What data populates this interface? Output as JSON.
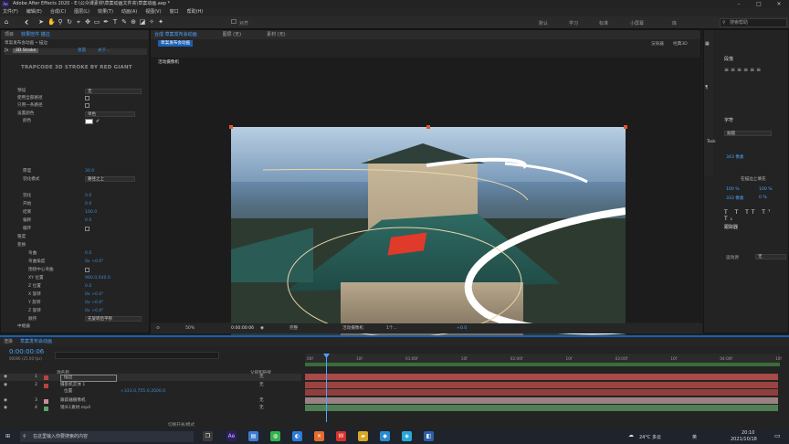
{
  "app": {
    "title": "Adobe After Effects 2020 - E:\\公众课素材\\草案动画文件夹\\草案动画.aep *"
  },
  "menu": [
    "文件(F)",
    "编辑(E)",
    "合成(C)",
    "图层(L)",
    "效果(T)",
    "动画(A)",
    "视图(V)",
    "窗口",
    "帮助(H)"
  ],
  "toolbar": {
    "snap_label": "对齐",
    "workspaces": [
      "默认",
      "学习",
      "标准",
      "小屏幕",
      "库"
    ],
    "search_placeholder": "搜索帮助"
  },
  "effects_panel": {
    "tabs": [
      "项目",
      "效果控件 描边"
    ],
    "header": "草案发布会动画 • 描边",
    "fx_name": "3D Stroke",
    "reset_label": "重置",
    "about_label": "关于...",
    "plugin_title": "TRAPCODE 3D STROKE BY RED GIANT",
    "rows": [
      {
        "label": "预设",
        "value": "无"
      },
      {
        "label": "使用全部路径",
        "value": ""
      },
      {
        "label": "只用一条路径",
        "value": ""
      },
      {
        "label": "设置颜色",
        "value": "单色"
      },
      {
        "label": "颜色",
        "value": ""
      },
      {
        "label": "厚度",
        "value": "30.0"
      },
      {
        "label": "羽化",
        "value": "0.0"
      },
      {
        "label": "开始",
        "value": "0.0"
      },
      {
        "label": "结束",
        "value": "100.0"
      },
      {
        "label": "偏移",
        "value": "0.0"
      },
      {
        "label": "循环",
        "value": ""
      },
      {
        "label": "锥度",
        "value": ""
      },
      {
        "label": "变换",
        "value": ""
      },
      {
        "label": "弯曲",
        "value": "0.0"
      },
      {
        "label": "弯曲角度",
        "value": "0x +0.0°"
      },
      {
        "label": "围绕中心弯曲",
        "value": ""
      },
      {
        "label": "XY 位置",
        "value": "960.0,540.0"
      },
      {
        "label": "Z 位置",
        "value": "0.0"
      },
      {
        "label": "X 旋转",
        "value": "0x +0.0°"
      },
      {
        "label": "Y 旋转",
        "value": "0x +0.0°"
      },
      {
        "label": "Z 旋转",
        "value": "0x +0.0°"
      },
      {
        "label": "顺序",
        "value": "先旋转后平移"
      },
      {
        "label": "中继器",
        "value": ""
      },
      {
        "label": "高级设置",
        "value": ""
      },
      {
        "label": "摄像机",
        "value": ""
      },
      {
        "label": "运动模糊",
        "value": ""
      },
      {
        "label": "不透明度",
        "value": "100.0"
      }
    ]
  },
  "viewer": {
    "tabs": [
      "合成 草案发布会动画",
      "图层 (无)",
      "素材 (无)"
    ],
    "sub_tab": "草案发布会动画",
    "renderer_label": "渲染器",
    "renderer_value": "经典3D",
    "camera_label": "活动摄像机",
    "zoom": "50%",
    "time": "0:00:00:06",
    "quality": "完整",
    "view_mode": "活动摄像机",
    "views": "1个...",
    "exposure": "+0.0"
  },
  "right_panel": {
    "align_title": "段落",
    "character_title": "字符",
    "font": "幼圆",
    "size_value": "343 像素",
    "tracking": "0",
    "stroke_label": "在描边上填充",
    "scale_v": "100 %",
    "scale_h": "100 %",
    "baseline": "333 像素",
    "tsume": "0 %",
    "tracker_title": "跟踪器",
    "motion_source_label": "运动源",
    "motion_source_value": "无",
    "task_label": "Task"
  },
  "timeline": {
    "tab_render": "渲染",
    "tab_comp": "草案发布会动画",
    "timecode": "0:00:00:06",
    "timecode_sub": "00006 (25.00 fps)",
    "col_source": "源名称",
    "col_parent": "父级和链接",
    "ruler": [
      "00f",
      "10f",
      "01:00f",
      "10f",
      "02:00f",
      "10f",
      "03:00f",
      "10f",
      "04:00f",
      "10f"
    ],
    "layers": [
      {
        "num": "1",
        "name": "描边",
        "parent": "无",
        "color": "#c04040"
      },
      {
        "num": "2",
        "name": "摄影机实体 1",
        "parent": "无",
        "color": "#c04040"
      },
      {
        "num": "",
        "name": "位置",
        "parent": "",
        "color": ""
      },
      {
        "num": "3",
        "name": "跟踪器摄像机",
        "parent": "无",
        "color": "#c69090"
      },
      {
        "num": "4",
        "name": "镜头1素材.mp4",
        "parent": "无",
        "color": "#5aa46a"
      }
    ],
    "position_value": "+333.0,755.0,3500.0",
    "footer": "切换开关/模式"
  },
  "taskbar": {
    "search_placeholder": "在这里输入你要搜索的内容",
    "weather": "24°C 多云",
    "time": "20:10",
    "date": "2021/10/18",
    "lang": "英"
  },
  "colors": {
    "accent": "#4da3ff",
    "selection": "#1a5fb4",
    "layer_bar_red": "#a84a48",
    "layer_bar_pink": "#9b8282",
    "layer_bar_green": "#4f7f55"
  }
}
